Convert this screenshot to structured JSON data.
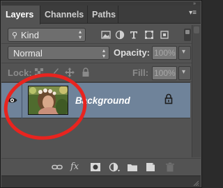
{
  "tabs": [
    {
      "label": "Layers",
      "active": true
    },
    {
      "label": "Channels",
      "active": false
    },
    {
      "label": "Paths",
      "active": false
    }
  ],
  "filter": {
    "kind_label": "Kind",
    "icons": [
      "pixel-filter-icon",
      "adjustment-filter-icon",
      "type-filter-icon",
      "shape-filter-icon",
      "smart-object-filter-icon"
    ]
  },
  "blend": {
    "mode": "Normal",
    "opacity_label": "Opacity:",
    "opacity_value": "100%"
  },
  "lock": {
    "label": "Lock:",
    "fill_label": "Fill:",
    "fill_value": "100%"
  },
  "layers": [
    {
      "name": "Background",
      "visible": true,
      "locked": true
    }
  ],
  "colors": {
    "panel_bg": "#535353",
    "selected_row": "#6f839a",
    "highlight_circle": "#e8241f"
  },
  "bottom_icons": [
    "link-layers-icon",
    "fx-icon",
    "add-mask-icon",
    "adjustment-layer-icon",
    "new-group-icon",
    "new-layer-icon",
    "delete-layer-icon"
  ]
}
